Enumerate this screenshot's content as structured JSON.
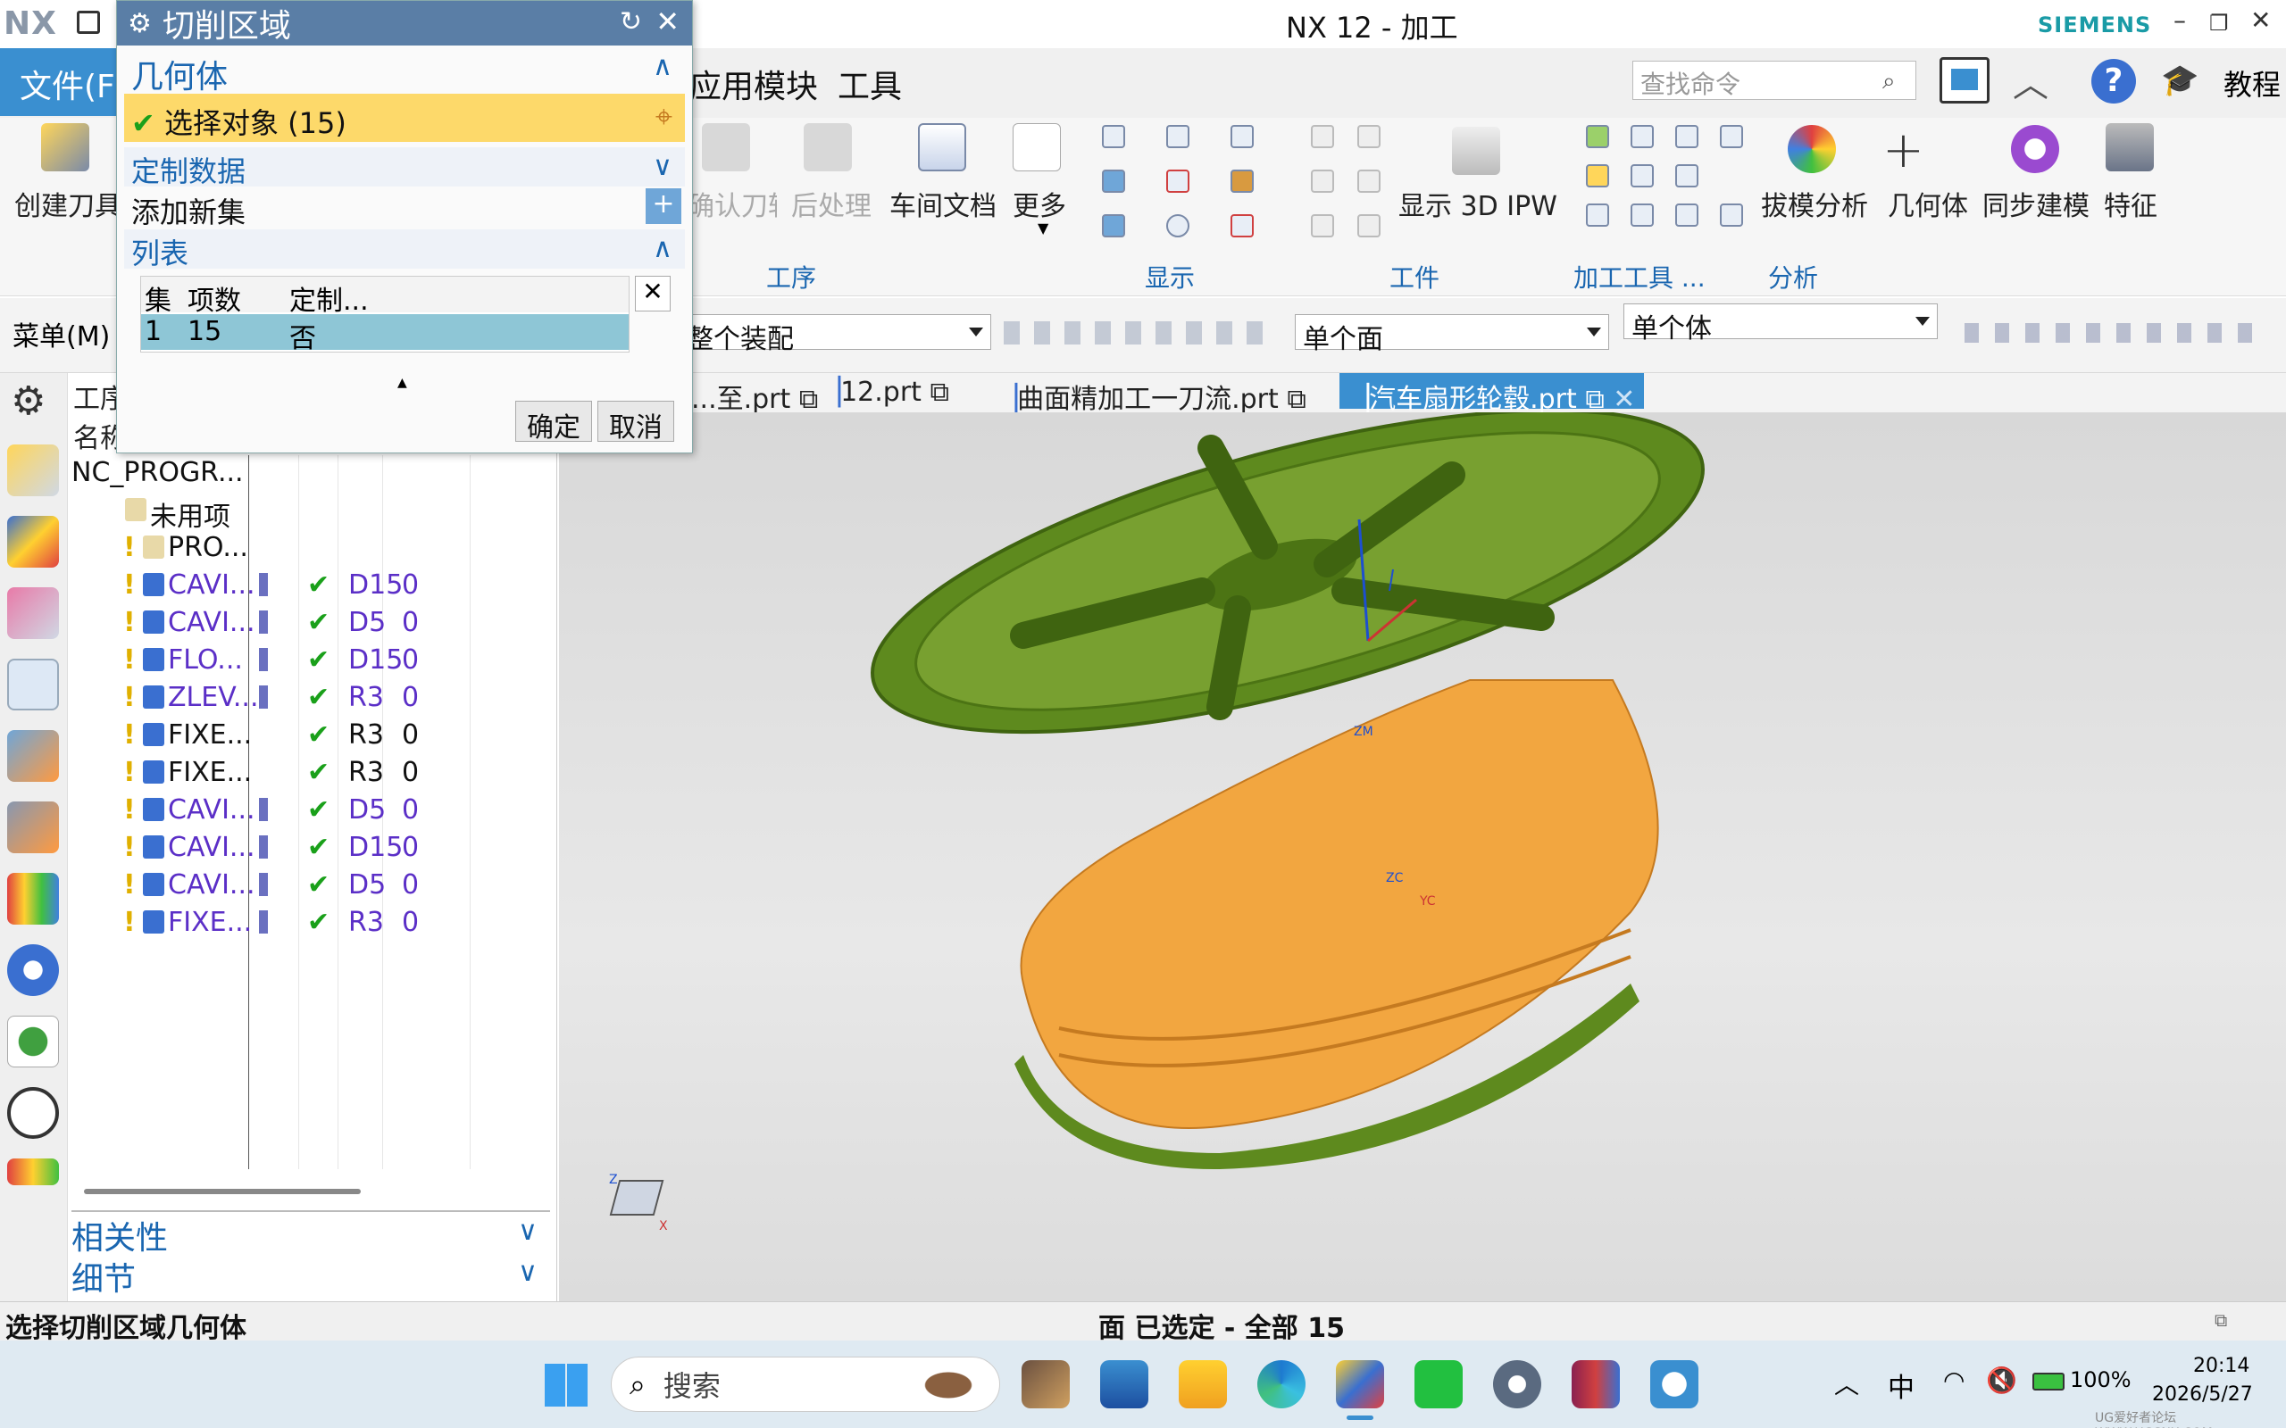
{
  "window": {
    "logo": "NX",
    "title": "NX 12 - 加工",
    "brand": "SIEMENS"
  },
  "menu": {
    "file": "文件(F)",
    "items": [
      "应用模块",
      "工具"
    ],
    "search_placeholder": "查找命令",
    "help_label": "教程",
    "menu_btn": "菜单(M)"
  },
  "ribbon": {
    "create_tool": "创建刀具",
    "confirm_path": "确认刀轨",
    "post_process": "后处理",
    "shop_doc": "车间文档",
    "more": "更多",
    "show_ipw": "显示 3D IPW",
    "draft_analysis": "拔模分析",
    "geometry": "几何体",
    "sync_modeling": "同步建模",
    "feature": "特征",
    "groups": [
      "工序",
      "显示",
      "工件",
      "加工工具 ...",
      "分析"
    ]
  },
  "toolbar": {
    "assembly": "整个装配",
    "face_filter": "单个面",
    "body_filter": "单个体"
  },
  "tabs": [
    {
      "label": "...至.prt"
    },
    {
      "label": "12.prt"
    },
    {
      "label": "曲面精加工一刀流.prt"
    },
    {
      "label": "汽车扇形轮毂.prt",
      "active": true
    }
  ],
  "navigator": {
    "header_op": "工序",
    "header_name": "名称",
    "rows": [
      {
        "name": "NC_PROGR...",
        "tool": "",
        "path": "",
        "color": "#111"
      },
      {
        "name": "未用项",
        "tool": "",
        "path": "",
        "color": "#111"
      },
      {
        "name": "PRO...",
        "tool": "",
        "path": "",
        "color": "#111"
      },
      {
        "name": "CAVI...",
        "tool": "D15",
        "path": "0",
        "color": "#5b2fc7"
      },
      {
        "name": "CAVI...",
        "tool": "D5",
        "path": "0",
        "color": "#5b2fc7"
      },
      {
        "name": "FLO...",
        "tool": "D15",
        "path": "0",
        "color": "#5b2fc7"
      },
      {
        "name": "ZLEV...",
        "tool": "R3",
        "path": "0",
        "color": "#5b2fc7"
      },
      {
        "name": "FIXE...",
        "tool": "R3",
        "path": "0",
        "color": "#111"
      },
      {
        "name": "FIXE...",
        "tool": "R3",
        "path": "0",
        "color": "#111"
      },
      {
        "name": "CAVI...",
        "tool": "D5",
        "path": "0",
        "color": "#5b2fc7"
      },
      {
        "name": "CAVI...",
        "tool": "D15",
        "path": "0",
        "color": "#5b2fc7"
      },
      {
        "name": "CAVI...",
        "tool": "D5",
        "path": "0",
        "color": "#5b2fc7"
      },
      {
        "name": "FIXE...",
        "tool": "R3",
        "path": "0",
        "color": "#5b2fc7"
      }
    ],
    "dependencies": "相关性",
    "details": "细节"
  },
  "dialog": {
    "title": "切削区域",
    "geometry": "几何体",
    "select_object": "选择对象 (15)",
    "custom_data": "定制数据",
    "add_set": "添加新集",
    "list": "列表",
    "cols": [
      "集",
      "项数",
      "定制..."
    ],
    "row": [
      "1",
      "15",
      "否"
    ],
    "ok": "确定",
    "cancel": "取消"
  },
  "viewport": {
    "axis_z": "ZM",
    "axis_zc": "ZC",
    "axis_yc": "YC",
    "triad_z": "Z",
    "triad_x": "X",
    "watermark": "UG爱好者论坛 WWW.UGSNX.COM"
  },
  "status": {
    "left": "选择切削区域几何体",
    "center": "面 已选定 - 全部 15"
  },
  "taskbar": {
    "search": "搜索",
    "ime": "中",
    "battery": "100%",
    "time": "20:14",
    "date": "2026/5/27"
  },
  "colors": {
    "accent": "#3a8fd0",
    "wheel_face": "#5e8a1e",
    "wheel_rim": "#f2a640"
  }
}
